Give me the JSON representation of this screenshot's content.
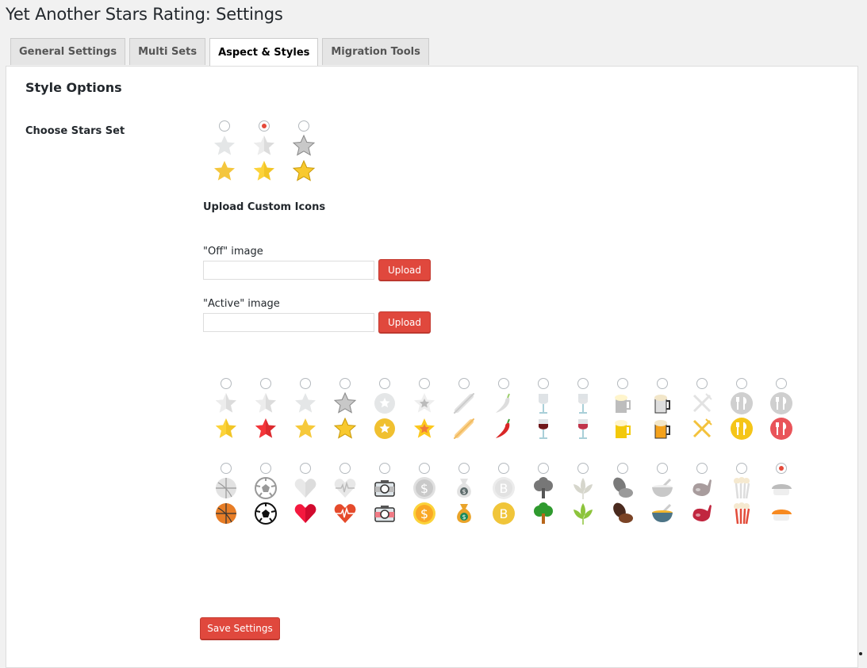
{
  "page": {
    "title": "Yet Another Stars Rating: Settings"
  },
  "tabs": [
    {
      "label": "General Settings",
      "active": false
    },
    {
      "label": "Multi Sets",
      "active": false
    },
    {
      "label": "Aspect & Styles",
      "active": true
    },
    {
      "label": "Migration Tools",
      "active": false
    }
  ],
  "section": {
    "title": "Style Options",
    "choose_label": "Choose Stars Set"
  },
  "default_sets": [
    {
      "name": "flat-star",
      "selected": false
    },
    {
      "name": "split-star",
      "selected": true
    },
    {
      "name": "glossy-star",
      "selected": false
    }
  ],
  "upload": {
    "title": "Upload Custom Icons",
    "off_label": "\"Off\" image",
    "off_value": "",
    "active_label": "\"Active\" image",
    "active_value": "",
    "button_label": "Upload"
  },
  "icon_sets": [
    {
      "name": "split-star-yellow",
      "selected": false
    },
    {
      "name": "star-red",
      "selected": false
    },
    {
      "name": "star-yellow",
      "selected": false
    },
    {
      "name": "glossy-star",
      "selected": false
    },
    {
      "name": "circle-star",
      "selected": false
    },
    {
      "name": "double-star",
      "selected": false
    },
    {
      "name": "rolling-pin",
      "selected": false
    },
    {
      "name": "chili-pepper",
      "selected": false
    },
    {
      "name": "red-wine",
      "selected": false
    },
    {
      "name": "rose-wine",
      "selected": false
    },
    {
      "name": "beer-yellow",
      "selected": false
    },
    {
      "name": "beer-mug",
      "selected": false
    },
    {
      "name": "cutlery-cross",
      "selected": false
    },
    {
      "name": "cutlery-yellow",
      "selected": false
    },
    {
      "name": "cutlery-red",
      "selected": false
    },
    {
      "name": "basketball",
      "selected": false
    },
    {
      "name": "soccer-ball",
      "selected": false
    },
    {
      "name": "heart",
      "selected": false
    },
    {
      "name": "heartbeat",
      "selected": false
    },
    {
      "name": "camera",
      "selected": false
    },
    {
      "name": "dollar-coin",
      "selected": false
    },
    {
      "name": "money-bag",
      "selected": false
    },
    {
      "name": "bitcoin",
      "selected": false
    },
    {
      "name": "tree",
      "selected": false
    },
    {
      "name": "leaf",
      "selected": false
    },
    {
      "name": "coffee-bean",
      "selected": false
    },
    {
      "name": "soup-bowl",
      "selected": false
    },
    {
      "name": "steak",
      "selected": false
    },
    {
      "name": "popcorn",
      "selected": false
    },
    {
      "name": "sushi",
      "selected": true
    }
  ],
  "save_button": "Save Settings"
}
